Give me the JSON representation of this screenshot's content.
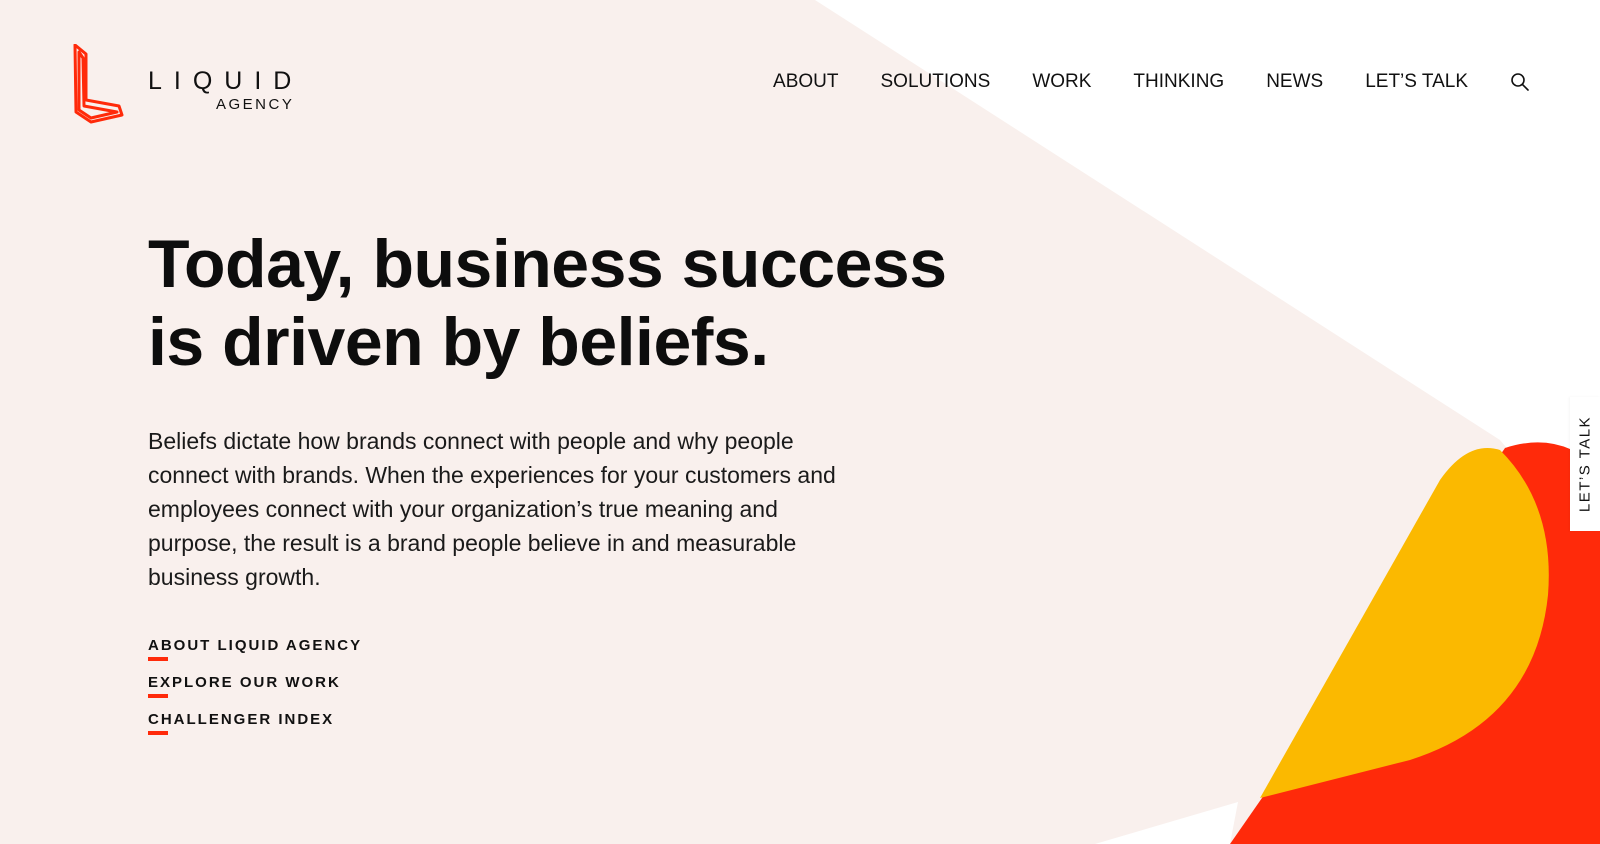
{
  "brand": {
    "name": "LIQUID",
    "sub": "AGENCY",
    "accent_color": "#ff2a0a",
    "secondary_color": "#fbb900",
    "background_tint": "#f9f0ed"
  },
  "nav": {
    "items": [
      {
        "label": "ABOUT"
      },
      {
        "label": "SOLUTIONS"
      },
      {
        "label": "WORK"
      },
      {
        "label": "THINKING"
      },
      {
        "label": "NEWS"
      },
      {
        "label": "LET’S TALK"
      }
    ],
    "search_icon": "search-icon"
  },
  "hero": {
    "title_line1": "Today, business success",
    "title_line2": "is driven by beliefs.",
    "body": "Beliefs dictate how brands connect with people and why people connect with brands. When the experiences for your customers and employees connect with your organization’s true meaning and purpose, the result is a brand people believe in and measurable business growth."
  },
  "links": [
    {
      "label": "ABOUT LIQUID AGENCY"
    },
    {
      "label": "EXPLORE OUR WORK"
    },
    {
      "label": "CHALLENGER INDEX"
    }
  ],
  "side_tab": {
    "label": "LET’S TALK"
  }
}
